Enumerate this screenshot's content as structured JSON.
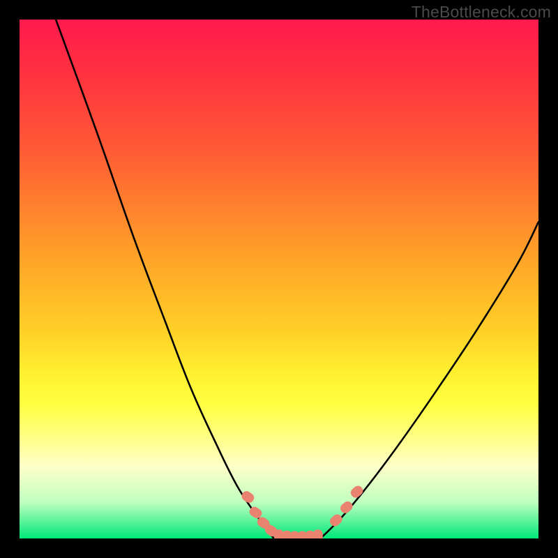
{
  "watermark": "TheBottleneck.com",
  "chart_data": {
    "type": "line",
    "title": "",
    "xlabel": "",
    "ylabel": "",
    "xlim": [
      0,
      100
    ],
    "ylim": [
      0,
      100
    ],
    "series": [
      {
        "name": "left-curve",
        "x": [
          7,
          15,
          22,
          28,
          33,
          38,
          42,
          46,
          49
        ],
        "y": [
          100,
          78,
          58,
          42,
          29,
          18,
          10,
          4,
          0
        ]
      },
      {
        "name": "right-curve",
        "x": [
          58,
          62,
          67,
          73,
          80,
          88,
          96,
          100
        ],
        "y": [
          0,
          4,
          10,
          18,
          28,
          40,
          53,
          61
        ]
      },
      {
        "name": "valley-floor",
        "x": [
          49,
          51,
          53,
          55,
          57,
          58
        ],
        "y": [
          0,
          0,
          0,
          0,
          0,
          0
        ]
      }
    ],
    "markers": [
      {
        "name": "left-marker-1",
        "x": 44,
        "y": 8
      },
      {
        "name": "left-marker-2",
        "x": 45.5,
        "y": 5
      },
      {
        "name": "left-marker-3",
        "x": 47,
        "y": 3
      },
      {
        "name": "left-marker-4",
        "x": 48.5,
        "y": 1.5
      },
      {
        "name": "floor-marker-1",
        "x": 50,
        "y": 0.5
      },
      {
        "name": "floor-marker-2",
        "x": 51.5,
        "y": 0.3
      },
      {
        "name": "floor-marker-3",
        "x": 53,
        "y": 0.2
      },
      {
        "name": "floor-marker-4",
        "x": 54.5,
        "y": 0.2
      },
      {
        "name": "floor-marker-5",
        "x": 56,
        "y": 0.3
      },
      {
        "name": "floor-marker-6",
        "x": 57.5,
        "y": 0.5
      },
      {
        "name": "right-marker-1",
        "x": 61,
        "y": 3.5
      },
      {
        "name": "right-marker-2",
        "x": 63,
        "y": 6
      },
      {
        "name": "right-marker-3",
        "x": 65,
        "y": 9
      }
    ],
    "colors": {
      "curve_stroke": "#000000",
      "marker_fill": "#e9836f",
      "background_top": "#ff1a4d",
      "background_bottom": "#00e878"
    }
  }
}
